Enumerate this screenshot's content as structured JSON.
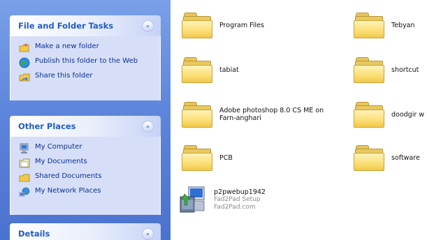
{
  "sidebar": {
    "panels": [
      {
        "title": "File and Folder Tasks",
        "collapse_glyph": "«",
        "items": [
          {
            "label": "Make a new folder",
            "icon": "new-folder-icon"
          },
          {
            "label": "Publish this folder to the Web",
            "icon": "globe-icon"
          },
          {
            "label": "Share this folder",
            "icon": "share-folder-icon"
          }
        ]
      },
      {
        "title": "Other Places",
        "collapse_glyph": "«",
        "items": [
          {
            "label": "My Computer",
            "icon": "computer-icon"
          },
          {
            "label": "My Documents",
            "icon": "documents-icon"
          },
          {
            "label": "Shared Documents",
            "icon": "shared-documents-icon"
          },
          {
            "label": "My Network Places",
            "icon": "network-icon"
          }
        ]
      },
      {
        "title": "Details",
        "collapse_glyph": "«"
      }
    ]
  },
  "content": {
    "items": [
      {
        "label": "Program Files",
        "icon": "folder-icon"
      },
      {
        "label": "Tebyan",
        "icon": "folder-icon"
      },
      {
        "label": "tabiat",
        "icon": "folder-icon"
      },
      {
        "label": "shortcut",
        "icon": "folder-icon"
      },
      {
        "label": "Adobe photoshop 8.0 CS ME on Farn-anghari",
        "icon": "folder-icon"
      },
      {
        "label": "doodgir w",
        "icon": "folder-icon"
      },
      {
        "label": "PCB",
        "icon": "folder-icon"
      },
      {
        "label": "software",
        "icon": "folder-icon"
      },
      {
        "label": "p2pwebup1942",
        "sub1": "Fad2Pad Setup",
        "sub2": "Fad2Pad.com",
        "icon": "installer-icon"
      }
    ]
  },
  "colors": {
    "sidebar_bg": "#5e86dc",
    "panel_title": "#215dc6",
    "link": "#0c2f93",
    "folder": "#f6d66b"
  }
}
